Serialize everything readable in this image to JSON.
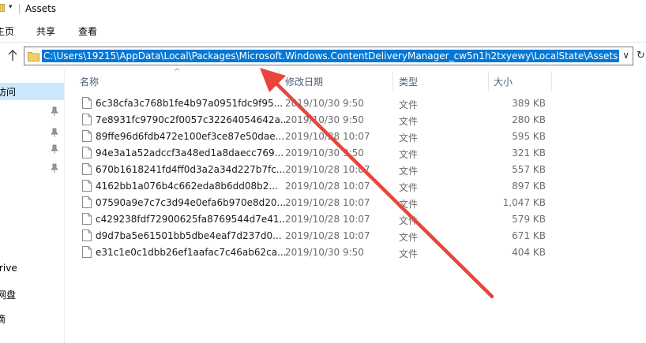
{
  "window": {
    "title": "Assets"
  },
  "ribbon": {
    "tabs": [
      "主页",
      "共享",
      "查看"
    ]
  },
  "address": {
    "path": "C:\\Users\\19215\\AppData\\Local\\Packages\\Microsoft.Windows.ContentDeliveryManager_cw5n1h2txyewy\\LocalState\\Assets"
  },
  "nav": {
    "items": [
      "访问",
      "rive",
      "网盘",
      "滴"
    ]
  },
  "columns": {
    "name": "名称",
    "date": "修改日期",
    "type": "类型",
    "size": "大小"
  },
  "files": [
    {
      "name": "6c38cfa3c768b1fe4b97a0951fdc9f95...",
      "date": "2019/10/30 9:50",
      "type": "文件",
      "size": "389 KB"
    },
    {
      "name": "7e8931fc9790c2f0057c32264054642a...",
      "date": "2019/10/30 9:50",
      "type": "文件",
      "size": "280 KB"
    },
    {
      "name": "89ffe96d6fdb472e100ef3ce87e50dae...",
      "date": "2019/10/28 10:07",
      "type": "文件",
      "size": "595 KB"
    },
    {
      "name": "94e3a1a52adccf3a48ed1a8daecc769...",
      "date": "2019/10/30 9:50",
      "type": "文件",
      "size": "321 KB"
    },
    {
      "name": "670b1618241fd4ff0d3a2a34d227b7fc...",
      "date": "2019/10/28 10:07",
      "type": "文件",
      "size": "557 KB"
    },
    {
      "name": "4162bb1a076b4c662eda8b6dd08b2...",
      "date": "2019/10/28 10:07",
      "type": "文件",
      "size": "897 KB"
    },
    {
      "name": "07590a9e7c7c3d94e0efa6b970e8d20...",
      "date": "2019/10/28 10:07",
      "type": "文件",
      "size": "1,047 KB"
    },
    {
      "name": "c429238fdf72900625fa8769544d7e41...",
      "date": "2019/10/28 10:07",
      "type": "文件",
      "size": "579 KB"
    },
    {
      "name": "d9d7ba5e61501bb5dbe4eaf7d237d0...",
      "date": "2019/10/28 10:07",
      "type": "文件",
      "size": "671 KB"
    },
    {
      "name": "e31c1e0c1dbb26ef1aafac7c46ab62ca...",
      "date": "2019/10/30 9:50",
      "type": "文件",
      "size": "404 KB"
    }
  ],
  "colors": {
    "accent": "#0078d7",
    "selection": "#cce8ff",
    "annotation": "#e8453c"
  }
}
